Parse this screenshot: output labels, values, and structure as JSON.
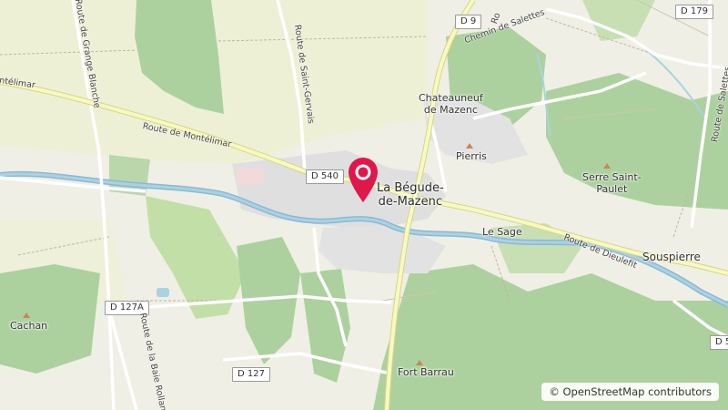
{
  "map": {
    "attribution": "© OpenStreetMap contributors",
    "marker_color": "#e0174b",
    "places": {
      "town": [
        "La Bégude-",
        "de-Mazenc"
      ],
      "chateauneuf": [
        "Chateauneuf",
        "de Mazenc"
      ],
      "pierris": "Pierris",
      "serre_saint_paulet": [
        "Serre Saint-",
        "Paulet"
      ],
      "le_sage": "Le Sage",
      "souspierre": "Souspierre",
      "cachan": "Cachan",
      "fort_barrau": "Fort Barrau"
    },
    "road_shields": {
      "d9": "D 9",
      "d179": "D 179",
      "d540": "D 540",
      "d127a": "D 127A",
      "d127": "D 127",
      "d54": "D 54"
    },
    "road_names": {
      "route_montelimar_1": "Route de Montélimar",
      "route_montelimar_2": "ntélimar",
      "route_grange_blanche": "Route de Grange Blanche",
      "route_saint_gervais": "Route de Saint-Gervais",
      "chemin_salettes": "Chemin de Salettes",
      "route_dieulefit": "Route de Dieulefit",
      "route_salettes": "Route de Salettes",
      "route_baie_rollan": "Route de la Baie Rollan",
      "route_r": "Ro"
    }
  }
}
